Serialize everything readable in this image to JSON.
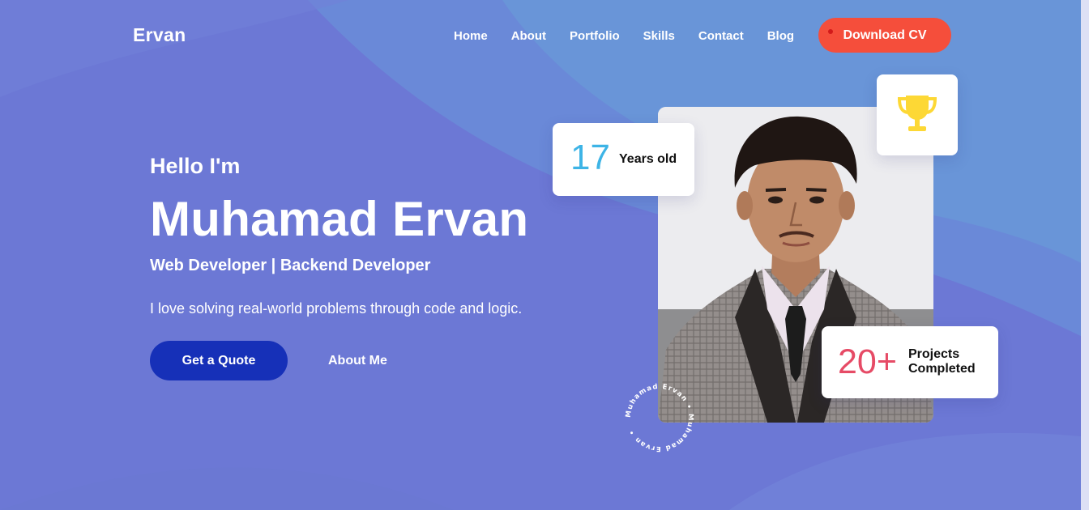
{
  "nav": {
    "logo": "Ervan",
    "items": [
      {
        "label": "Home"
      },
      {
        "label": "About"
      },
      {
        "label": "Portfolio"
      },
      {
        "label": "Skills"
      },
      {
        "label": "Contact"
      },
      {
        "label": "Blog"
      }
    ],
    "cta_label": "Download CV"
  },
  "hero": {
    "greeting": "Hello I'm",
    "name": "Muhamad Ervan",
    "role": "Web Developer | Backend Developer",
    "tagline": "I love solving real-world problems through code and logic.",
    "primary_button": "Get a Quote",
    "secondary_link": "About Me"
  },
  "stats": {
    "age_value": "17",
    "age_label": "Years old",
    "projects_value": "20+",
    "projects_label_line1": "Projects",
    "projects_label_line2": "Completed"
  },
  "badge": {
    "circular_text": "Muhamad Ervan • Muhamad Ervan •"
  },
  "icons": {
    "trophy": "trophy-icon",
    "portrait": "profile-photo"
  },
  "colors": {
    "background": "#6c79d6",
    "cta": "#f54e3b",
    "primary_button": "#1630b8",
    "age_accent": "#3db4e6",
    "projects_accent": "#e64b66",
    "trophy": "#fdd835"
  }
}
